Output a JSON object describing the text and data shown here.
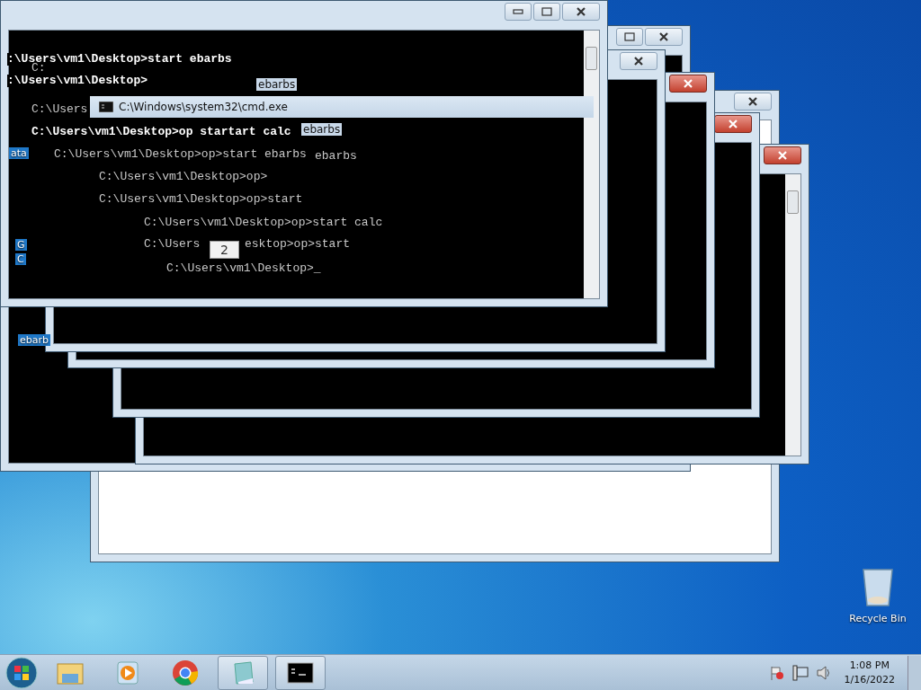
{
  "windows": [
    {
      "focused": false
    },
    {
      "focused": false
    },
    {
      "focused": true
    },
    {
      "focused": true
    },
    {
      "focused": true
    },
    {
      "focused": false
    },
    {
      "focused": false
    }
  ],
  "window_title": "C:\\Windows\\system32\\cmd.exe",
  "title_fragments": [
    "ebarbs",
    "ebarbs"
  ],
  "console_lines": [
    {
      "text": ":\\Users\\vm1\\Desktop>start ebarbs",
      "highlighted": true
    },
    {
      "text": "C:",
      "highlighted": false
    },
    {
      "text": ":\\Users\\vm1\\Desktop>",
      "highlighted": true
    },
    {
      "text": "C:\\Users",
      "highlighted": false
    },
    {
      "text": "C:\\Users\\vm1\\Desktop>op startart calc",
      "highlighted": true
    },
    {
      "text": "C:\\Users\\vm1\\Desktop>op>start ebarbs",
      "highlighted": false
    },
    {
      "text": "ebarbs",
      "highlighted": false
    },
    {
      "text": "C:\\Users\\vm1\\Desktop>op>",
      "highlighted": false
    },
    {
      "text": "C:\\Users\\vm1\\Desktop>op>start",
      "highlighted": false
    },
    {
      "text": "C:\\Users\\vm1\\Desktop>op>start calc",
      "highlighted": false
    },
    {
      "text": "C:\\Users",
      "highlighted": false
    },
    {
      "text": "esktop>op>start",
      "highlighted": false
    },
    {
      "text": "C:\\Users\\vm1\\Desktop>_",
      "highlighted": false
    }
  ],
  "tooltip": "2",
  "desktop_icons": [
    {
      "label": "ata"
    },
    {
      "label": "G"
    },
    {
      "label": "C"
    },
    {
      "label": "ebarb"
    },
    {
      "label": "Recycle Bin"
    }
  ],
  "taskbar": {
    "items": [
      {
        "kind": "explorer",
        "running": false
      },
      {
        "kind": "media",
        "running": false
      },
      {
        "kind": "chrome",
        "running": false
      },
      {
        "kind": "notepad",
        "running": true
      },
      {
        "kind": "console",
        "running": true
      }
    ],
    "clock": {
      "time": "1:08 PM",
      "date": "1/16/2022"
    }
  }
}
